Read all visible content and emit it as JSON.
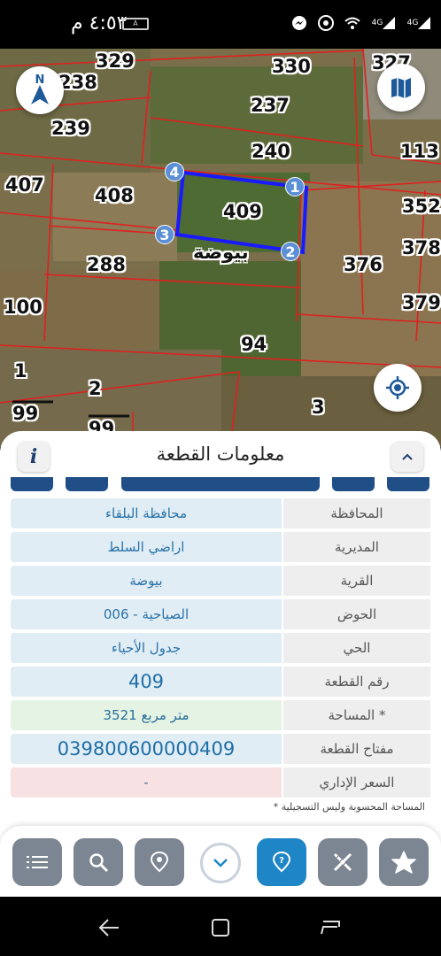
{
  "status_bar": {
    "time": "٤:٥٣ م",
    "battery": "A",
    "network_left": "4G",
    "network_right": "4G"
  },
  "map": {
    "plot_numbers": [
      "329",
      "330",
      "327",
      "238",
      "237",
      "239",
      "240",
      "113",
      "407",
      "408",
      "409",
      "352",
      "378",
      "288",
      "376",
      "379",
      "100",
      "94",
      "2",
      "3"
    ],
    "fraction_top": "1",
    "fraction_bottom": "99",
    "fraction2_bottom": "99",
    "selected_plot_village": "بيوضة",
    "corners": [
      "1",
      "2",
      "3",
      "4"
    ],
    "compass_letter": "N"
  },
  "panel": {
    "title": "معلومات القطعة",
    "info_icon": "i",
    "rows": [
      {
        "label": "المحافظة",
        "value": "محافظة البلقاء"
      },
      {
        "label": "المديرية",
        "value": "اراضي السلط"
      },
      {
        "label": "القرية",
        "value": "بيوضة"
      },
      {
        "label": "الحوض",
        "value": "الصياحية - 006"
      },
      {
        "label": "الحي",
        "value": "جدول الأحياء"
      },
      {
        "label": "رقم القطعة",
        "value": "409"
      },
      {
        "label": "المساحة *",
        "value": "3521  متر مربع"
      },
      {
        "label": "مفتاح القطعة",
        "value": "039800600000409"
      },
      {
        "label": "السعر الإداري",
        "value": "-"
      }
    ],
    "footnote": "* المساحة المحسوبة وليس التسجيلية"
  },
  "toolbar": {
    "buttons": [
      "list-icon",
      "search-icon",
      "location-pin-icon",
      "chevron-down-icon",
      "help-pin-icon",
      "measure-tools-icon",
      "star-shape-icon"
    ]
  },
  "colors": {
    "panel_value_bg": "#e0edf5",
    "accent_blue": "#1e86c6",
    "parcel_border": "#e02020",
    "selected_border": "#1a1aff"
  }
}
